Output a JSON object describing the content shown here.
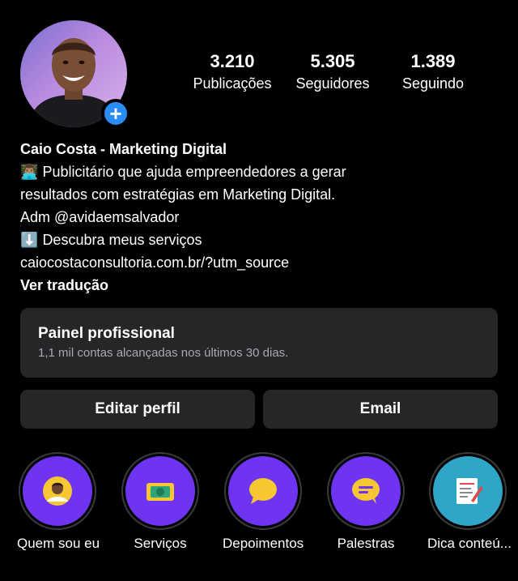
{
  "profile": {
    "stats": [
      {
        "value": "3.210",
        "label": "Publicações"
      },
      {
        "value": "5.305",
        "label": "Seguidores"
      },
      {
        "value": "1.389",
        "label": "Seguindo"
      }
    ],
    "name": "Caio Costa - Marketing Digital",
    "bio_line1": "Publicitário que ajuda empreendedores a gerar",
    "bio_line2": "resultados com estratégias em Marketing Digital.",
    "bio_line3": "Adm @avidaemsalvador",
    "bio_line4": "Descubra meus serviços",
    "link": "caiocostaconsultoria.com.br/?utm_source",
    "translate": "Ver tradução",
    "bio_emoji1": "👨🏽‍💻",
    "bio_emoji2": "⬇️",
    "add_icon": "+"
  },
  "panel": {
    "title": "Painel profissional",
    "subtitle": "1,1 mil contas alcançadas nos últimos 30 dias."
  },
  "buttons": {
    "edit": "Editar perfil",
    "email": "Email"
  },
  "highlights": [
    {
      "label": "Quem sou eu",
      "icon": "person-icon"
    },
    {
      "label": "Serviços",
      "icon": "money-icon"
    },
    {
      "label": "Depoimentos",
      "icon": "speech-bubble-icon"
    },
    {
      "label": "Palestras",
      "icon": "message-icon"
    },
    {
      "label": "Dica conteú...",
      "icon": "notepad-icon"
    }
  ],
  "colors": {
    "accent_blue": "#2a8cf5",
    "highlight_purple": "#6f34f2",
    "highlight_teal": "#2fa5c7",
    "surface": "#262628"
  }
}
